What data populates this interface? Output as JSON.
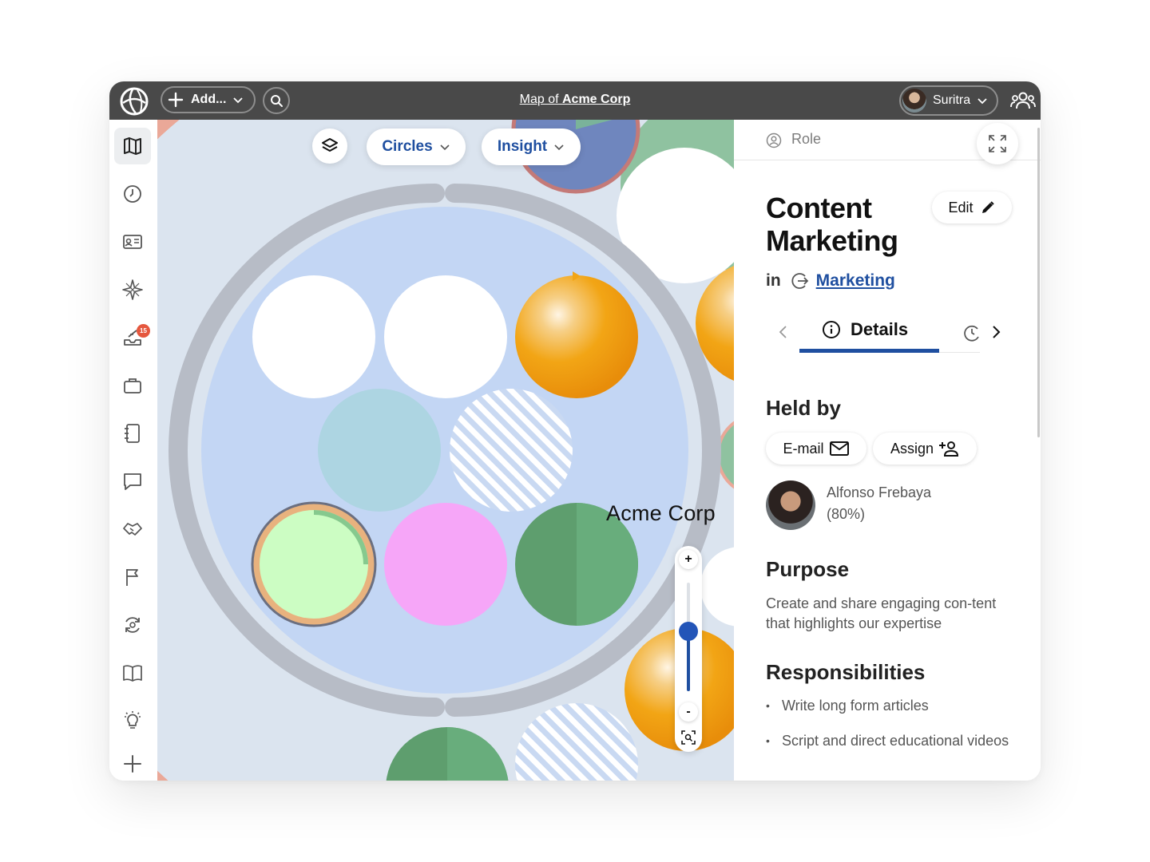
{
  "topbar": {
    "add_label": "Add...",
    "map_title_prefix": "Map of",
    "map_title_org": "Acme Corp",
    "user_name": "Suritra"
  },
  "sidebar": {
    "items": [
      {
        "icon": "map-icon",
        "active": true
      },
      {
        "icon": "clock-icon"
      },
      {
        "icon": "id-card-icon"
      },
      {
        "icon": "compass-star-icon"
      },
      {
        "icon": "inbox-icon",
        "badge": "15"
      },
      {
        "icon": "briefcase-icon"
      },
      {
        "icon": "notebook-icon"
      },
      {
        "icon": "chat-icon"
      },
      {
        "icon": "handshake-icon"
      },
      {
        "icon": "flag-icon"
      },
      {
        "icon": "sync-icon"
      },
      {
        "icon": "book-icon"
      },
      {
        "icon": "lightbulb-icon"
      },
      {
        "icon": "plus-icon"
      }
    ]
  },
  "map": {
    "circles_label": "Circles",
    "insight_label": "Insight",
    "org_label": "Acme Corp",
    "zoom_in": "+",
    "zoom_out": "-",
    "zoom_level": 0.55
  },
  "panel": {
    "type_label": "Role",
    "title": "Content Marketing",
    "edit_label": "Edit",
    "in_label": "in",
    "parent_circle": "Marketing",
    "active_tab": "Details",
    "held_by_heading": "Held by",
    "email_label": "E-mail",
    "assign_label": "Assign",
    "holder_name": "Alfonso Frebaya",
    "holder_share": "(80%)",
    "purpose_heading": "Purpose",
    "purpose_text": "Create and share engaging con-tent that highlights our expertise",
    "responsibilities_heading": "Responsibilities",
    "responsibilities": [
      "Write long form articles",
      "Script and direct educational videos"
    ]
  },
  "colors": {
    "topbar": "#494949",
    "accent": "#1f4fa0",
    "orange": "#f2a515",
    "green": "#5e9e6e",
    "pink": "#f6a6f8",
    "light_green": "#ccfdc3"
  }
}
